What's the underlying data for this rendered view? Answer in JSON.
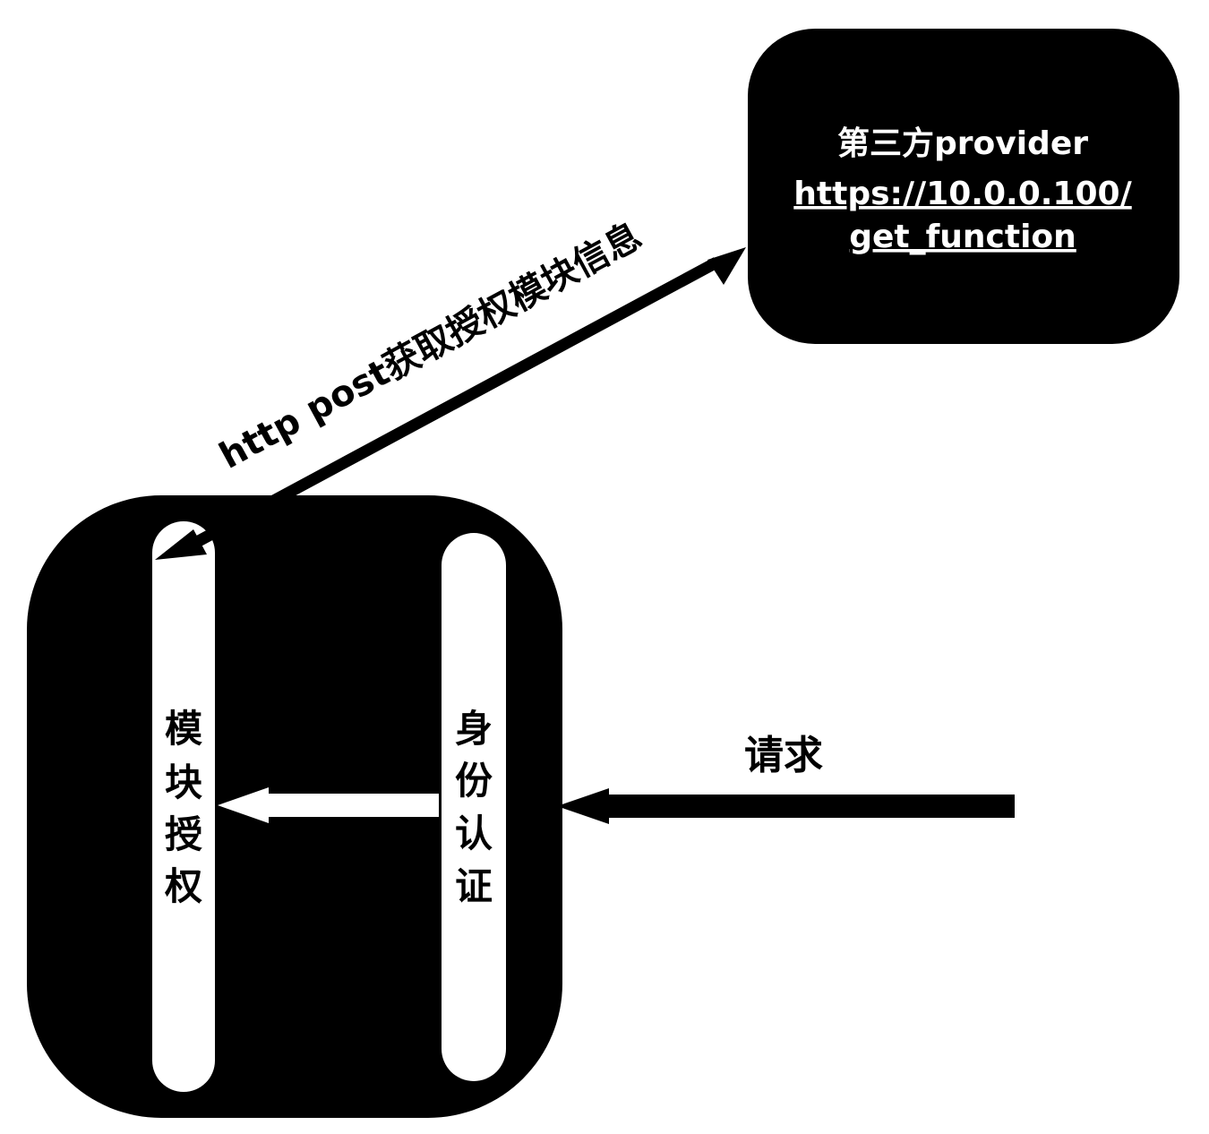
{
  "provider": {
    "title": "第三方provider",
    "url_line1": "https://10.0.0.100/",
    "url_line2": "get_function"
  },
  "arrows": {
    "http_post_label": "http post获取授权模块信息",
    "request_label": "请求"
  },
  "gateway": {
    "module_auth_chars": [
      "模",
      "块",
      "授",
      "权"
    ],
    "identity_auth_chars": [
      "身",
      "份",
      "认",
      "证"
    ]
  },
  "colors": {
    "box_fill": "#000000",
    "column_fill": "#ffffff",
    "arrow": "#000000",
    "inner_arrow": "#ffffff",
    "background": "#ffffff"
  }
}
